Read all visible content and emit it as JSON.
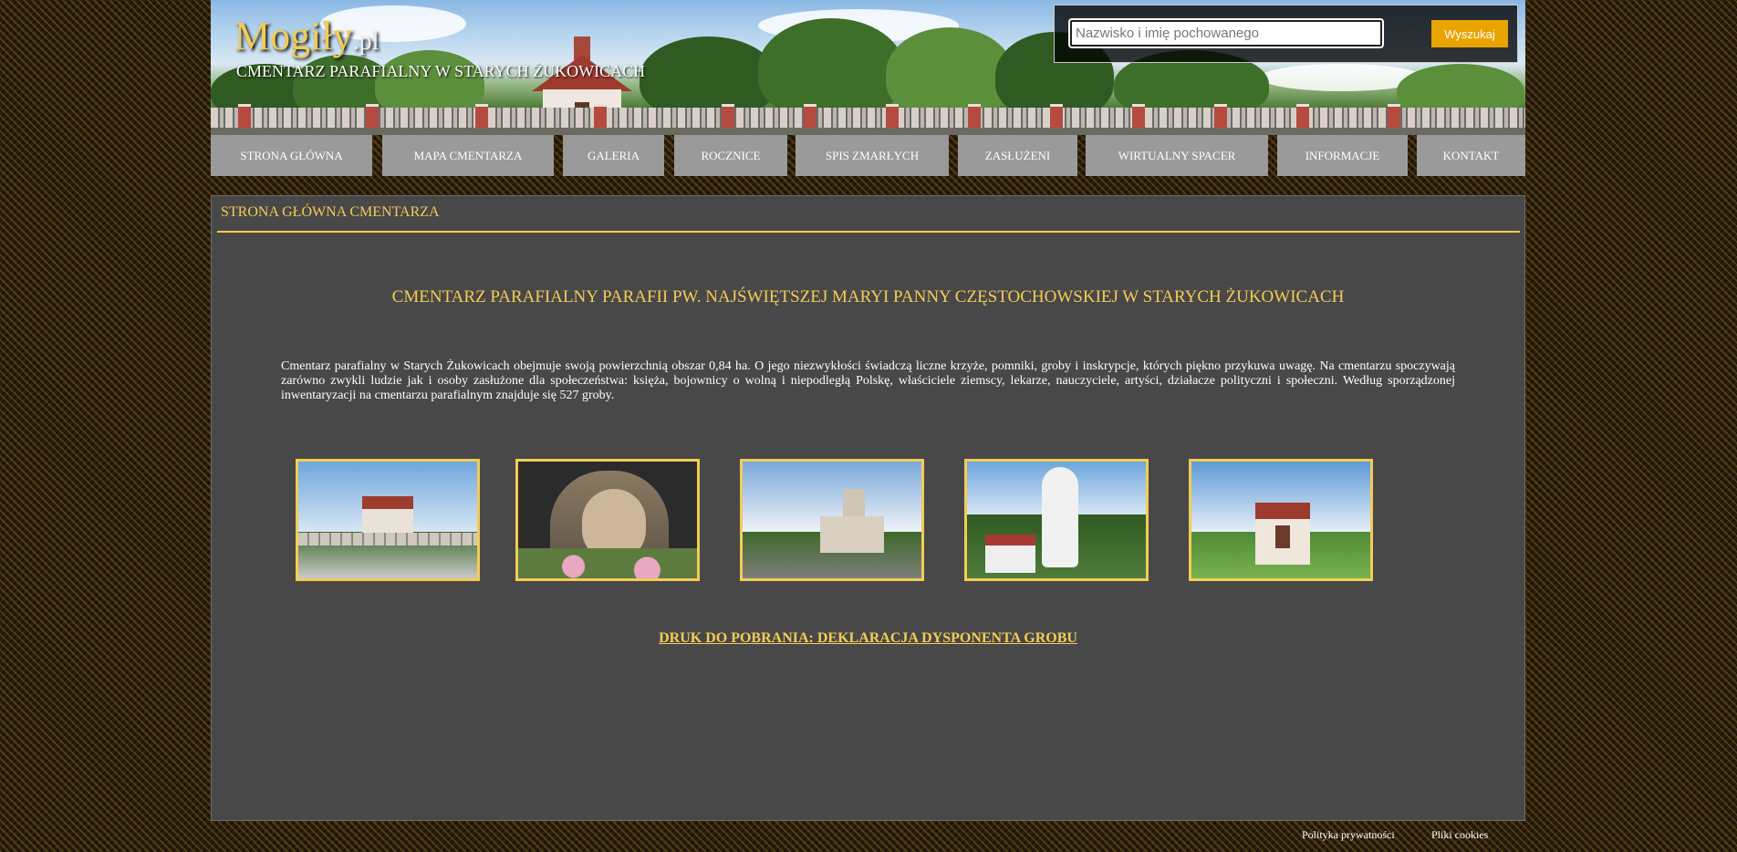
{
  "header": {
    "logo_main": "Mogiły",
    "logo_tld": ".pl",
    "subtitle": "CMENTARZ PARAFIALNY W STARYCH ŻUKOWICACH"
  },
  "search": {
    "placeholder": "Nazwisko i imię pochowanego",
    "value": "",
    "button_label": "Wyszukaj"
  },
  "nav": {
    "items": [
      {
        "label": "STRONA GŁÓWNA"
      },
      {
        "label": "MAPA CMENTARZA"
      },
      {
        "label": "GALERIA"
      },
      {
        "label": "ROCZNICE"
      },
      {
        "label": "SPIS ZMARŁYCH"
      },
      {
        "label": "ZASŁUŻENI"
      },
      {
        "label": "WIRTUALNY SPACER"
      },
      {
        "label": "INFORMACJE"
      },
      {
        "label": "KONTAKT"
      }
    ]
  },
  "main": {
    "section_title": "STRONA GŁÓWNA CMENTARZA",
    "headline": "CMENTARZ PARAFIALNY PARAFII PW. NAJŚWIĘTSZEJ MARYI PANNY CZĘSTOCHOWSKIEJ W STARYCH ŻUKOWICACH",
    "intro": "Cmentarz parafialny w Starych Żukowicach obejmuje swoją powierzchnią obszar 0,84 ha. O jego niezwykłości świadczą liczne krzyże, pomniki, groby i inskrypcje, których piękno przykuwa uwagę. Na cmentarzu spoczywają zarówno zwykli ludzie jak i osoby zasłużone dla społeczeństwa: księża, bojownicy o wolną i niepodległą Polskę, właściciele ziemscy, lekarze, nauczyciele, artyści, działacze polityczni i społeczni. Według sporządzonej inwentaryzacji na cmentarzu parafialnym znajduje się 527 groby.",
    "download_label": "DRUK DO POBRANIA:  DEKLARACJA DYSPONENTA GROBU"
  },
  "footer": {
    "privacy": "Polityka prywatności",
    "cookies": "Pliki cookies"
  },
  "colors": {
    "accent": "#f3cc55",
    "panel": "#484848",
    "nav": "#9a9a9a",
    "button": "#eaa400"
  }
}
